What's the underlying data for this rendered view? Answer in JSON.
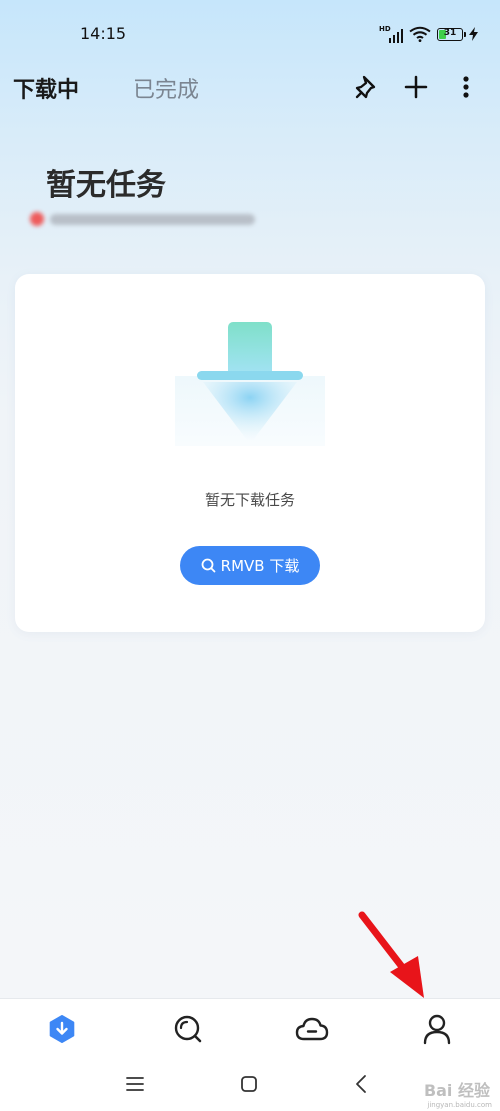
{
  "status_bar": {
    "time": "14:15",
    "signal_label": "HD",
    "battery_level": "31",
    "battery_fraction": 0.31
  },
  "header": {
    "tabs": [
      {
        "label": "下载中",
        "active": true
      },
      {
        "label": "已完成",
        "active": false
      }
    ],
    "actions": [
      "pin-icon",
      "plus-icon",
      "more-icon"
    ]
  },
  "main": {
    "empty_title": "暂无任务",
    "empty_card": {
      "message": "暂无下载任务",
      "search_button_label": "RMVB 下载"
    }
  },
  "bottom_nav": {
    "items": [
      {
        "icon": "download-icon",
        "active": true
      },
      {
        "icon": "discover-icon",
        "active": false
      },
      {
        "icon": "cloud-icon",
        "active": false
      },
      {
        "icon": "profile-icon",
        "active": false
      }
    ]
  },
  "system_nav": {
    "buttons": [
      "menu-icon",
      "home-icon",
      "back-icon"
    ]
  },
  "watermark": {
    "text": "Bai 经验",
    "subtext": "jingyan.baidu.com"
  },
  "colors": {
    "accent": "#3d87f5",
    "annotation": "#e8141a",
    "battery": "#3fcf4b"
  }
}
